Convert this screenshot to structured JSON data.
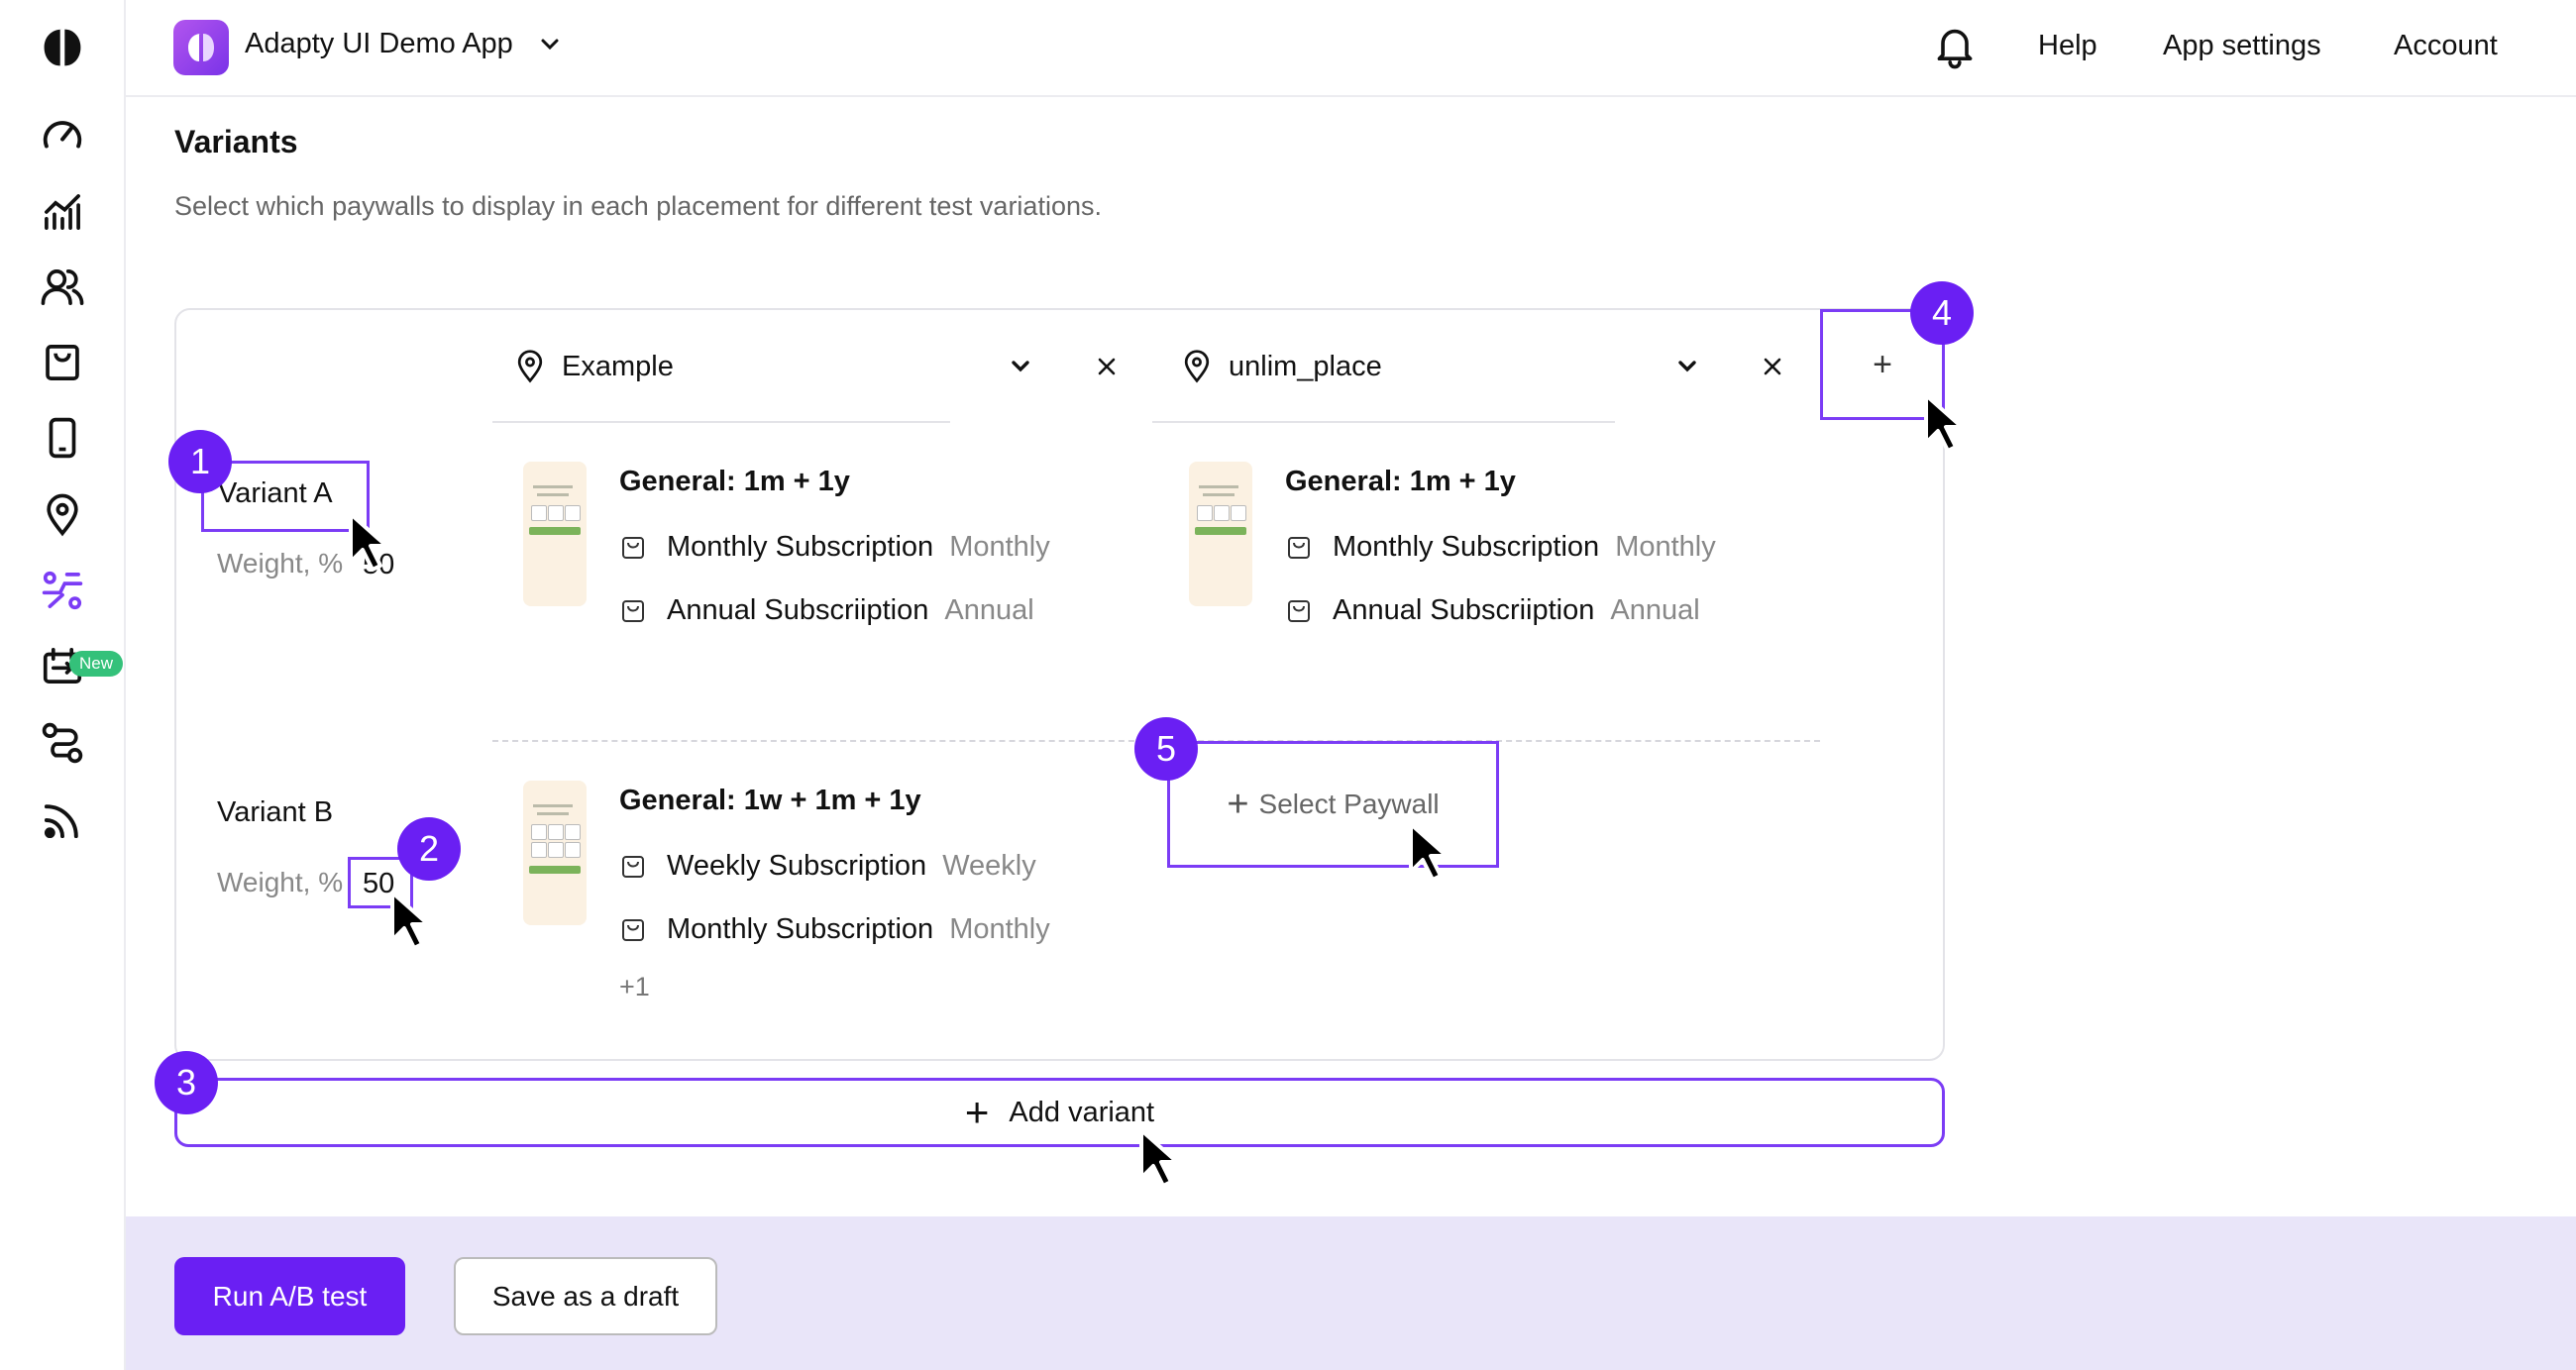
{
  "app": {
    "name": "Adapty UI Demo App"
  },
  "topnav": {
    "help": "Help",
    "app_settings": "App settings",
    "account": "Account"
  },
  "sidebar": {
    "new_badge": "New"
  },
  "section": {
    "title": "Variants",
    "description": "Select which paywalls to display in each placement for different test variations."
  },
  "placements": [
    {
      "name": "Example"
    },
    {
      "name": "unlim_place"
    }
  ],
  "add_placement_label": "+",
  "weight_label": "Weight, %",
  "variants": [
    {
      "name": "Variant A",
      "weight": "50",
      "paywalls": [
        {
          "title": "General: 1m + 1y",
          "products": [
            {
              "name": "Monthly Subscription",
              "period": "Monthly"
            },
            {
              "name": "Annual Subscriiption",
              "period": "Annual"
            }
          ]
        },
        {
          "title": "General: 1m + 1y",
          "products": [
            {
              "name": "Monthly Subscription",
              "period": "Monthly"
            },
            {
              "name": "Annual Subscriiption",
              "period": "Annual"
            }
          ]
        }
      ]
    },
    {
      "name": "Variant B",
      "weight": "50",
      "paywalls": [
        {
          "title": "General: 1w + 1m + 1y",
          "products": [
            {
              "name": "Weekly Subscription",
              "period": "Weekly"
            },
            {
              "name": "Monthly Subscription",
              "period": "Monthly"
            }
          ],
          "more": "+1"
        }
      ],
      "select_paywall": "Select Paywall"
    }
  ],
  "add_variant": "Add variant",
  "steps": [
    "1",
    "2",
    "3",
    "4",
    "5"
  ],
  "footer": {
    "run": "Run A/B test",
    "draft": "Save as a draft"
  },
  "colors": {
    "accent": "#6a1ff3",
    "highlight": "#7b3cf5",
    "footer_bg": "#e9e5f9",
    "badge": "#34c17a"
  }
}
